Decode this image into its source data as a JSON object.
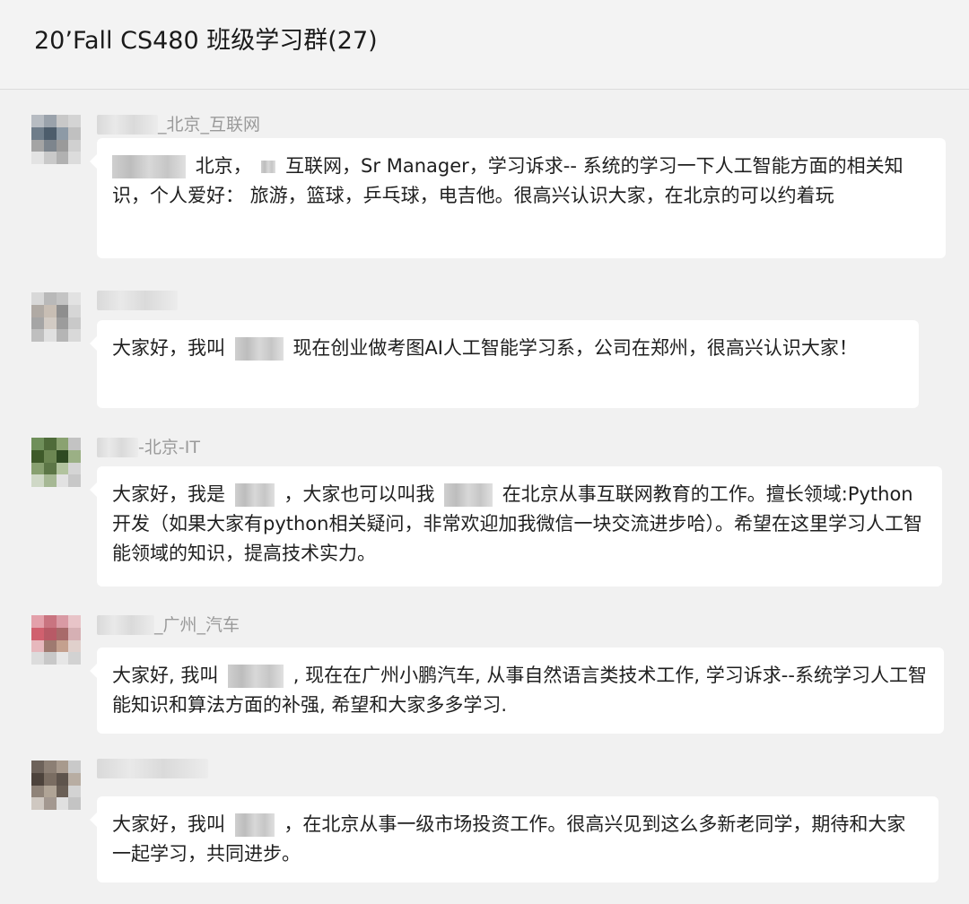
{
  "chat": {
    "title": "20’Fall CS480 班级学习群(27)"
  },
  "messages": [
    {
      "sender_suffix": "_北京_互联网",
      "avatar_colors": [
        "#b7bcc2",
        "#9aa2ab",
        "#c8c8c8",
        "#d4d4d4",
        "#6f7d8a",
        "#4d5d6c",
        "#8d9aa6",
        "#c0c0c0",
        "#a4a4a4",
        "#7d858d",
        "#9a9a9a",
        "#d0d0d0",
        "#e3e3e3",
        "#c9c9c9",
        "#b1b1b1",
        "#dcdcdc"
      ],
      "parts": [
        "北京，",
        "互联网，Sr Manager，学习诉求-- 系统的学习一下人工智能方面的相关知识，个人爱好： 旅游，篮球，乒乓球，电吉他。很高兴认识大家，在北京的可以约着玩"
      ]
    },
    {
      "sender_suffix": "",
      "avatar_colors": [
        "#d8d8d8",
        "#b9b9b9",
        "#c4c4c4",
        "#e2e2e2",
        "#b0aaa4",
        "#c8beb4",
        "#8e8e8e",
        "#d6d6d6",
        "#a5a5a5",
        "#d2cbc4",
        "#9c9c9c",
        "#c9c9c9",
        "#bfbfbf",
        "#e0e0e0",
        "#b5b5b5",
        "#d9d9d9"
      ],
      "parts": [
        "大家好，我叫",
        "现在创业做考图AI人工智能学习系，公司在郑州，很高兴认识大家！"
      ]
    },
    {
      "sender_suffix": "-北京-IT",
      "avatar_colors": [
        "#6f8f5a",
        "#4f6b3a",
        "#8aa271",
        "#c3c3c3",
        "#3f5a2a",
        "#6c8652",
        "#2f4a22",
        "#9bb085",
        "#88a070",
        "#5c7646",
        "#b2c39e",
        "#d5d5d5",
        "#cfd8c6",
        "#a6b894",
        "#e2e2e2",
        "#c8c8c8"
      ],
      "parts": [
        "大家好，我是",
        "，大家也可以叫我",
        "在北京从事互联网教育的工作。擅长领域:Python开发（如果大家有python相关疑问，非常欢迎加我微信一块交流进步哈）。希望在这里学习人工智能领域的知识，提高技术实力。"
      ]
    },
    {
      "sender_suffix": "_广州_汽车",
      "avatar_colors": [
        "#e3a0aa",
        "#c97480",
        "#d99aa4",
        "#e8c4c8",
        "#d0606e",
        "#b85a66",
        "#a86a6a",
        "#d6b0b4",
        "#e7b8bd",
        "#9f7a70",
        "#c4a08e",
        "#e0d0cc",
        "#dcdcdc",
        "#c8c8c8",
        "#e6e6e6",
        "#d2d2d2"
      ],
      "parts": [
        "大家好, 我叫",
        ", 现在在广州小鹏汽车, 从事自然语言类技术工作, 学习诉求--系统学习人工智能知识和算法方面的补强, 希望和大家多多学习."
      ]
    },
    {
      "sender_suffix": "",
      "avatar_colors": [
        "#6d625a",
        "#8c7f74",
        "#a89a8d",
        "#c9c9c9",
        "#4d433c",
        "#7a6d62",
        "#5e544c",
        "#b8ada2",
        "#8f8378",
        "#b0a496",
        "#6a5f56",
        "#d3d3d3",
        "#cfc8c1",
        "#a39890",
        "#e0e0e0",
        "#c4c4c4"
      ],
      "parts": [
        "大家好，我叫",
        "，在北京从事一级市场投资工作。很高兴见到这么多新老同学，期待和大家一起学习，共同进步。"
      ]
    }
  ]
}
